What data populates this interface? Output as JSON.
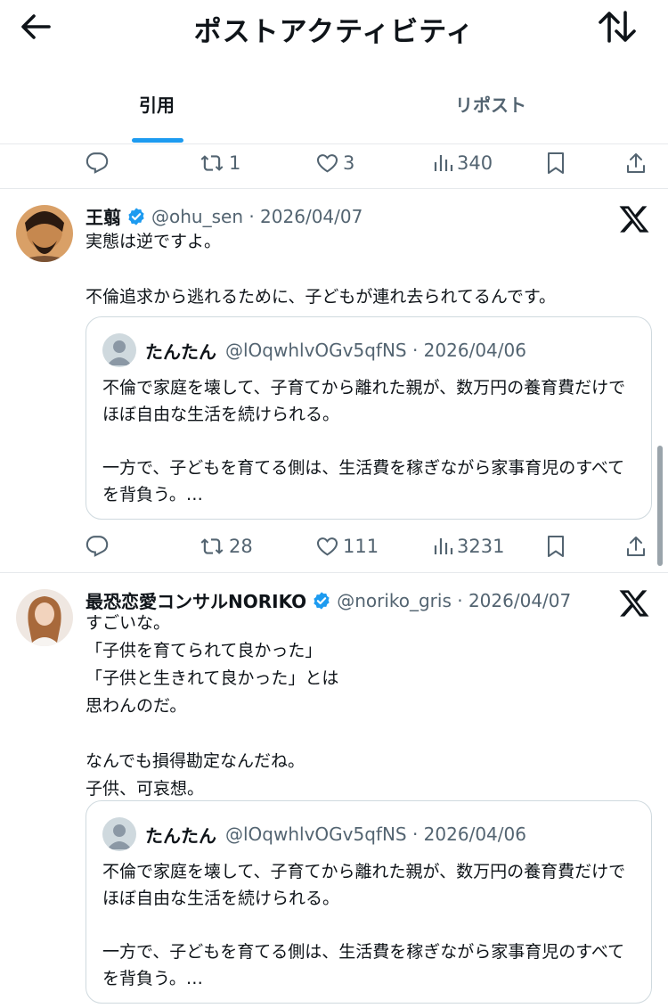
{
  "header": {
    "title": "ポストアクティビティ",
    "back_icon": "arrow-left-icon",
    "sort_icon": "sort-arrows-icon"
  },
  "tabs": [
    {
      "label": "引用",
      "active": true
    },
    {
      "label": "リポスト",
      "active": false
    }
  ],
  "top_actions": {
    "replies": "",
    "reposts": "1",
    "likes": "3",
    "views": "340"
  },
  "posts": [
    {
      "author": "王翦",
      "verified": true,
      "handle_date": "@ohu_sen · 2026/04/07",
      "body": "実態は逆ですよ。\n\n不倫追求から逃れるために、子どもが連れ去られてるんです。",
      "quote": {
        "author": "たんたん",
        "handle_date": "@lOqwhlvOGv5qfNS · 2026/04/06",
        "body": "不倫で家庭を壊して、子育てから離れた親が、数万円の養育費だけでほぼ自由な生活を続けられる。\n\n一方で、子どもを育てる側は、生活費を稼ぎながら家事育児のすべてを背負う。…"
      },
      "actions": {
        "replies": "",
        "reposts": "28",
        "likes": "111",
        "views": "3231"
      }
    },
    {
      "author": "最恐恋愛コンサルNORIKO",
      "verified": true,
      "handle_date": "@noriko_gris · 2026/04/07",
      "body": "すごいな。\n「子供を育てられて良かった」\n「子供と生きれて良かった」とは\n思わんのだ。\n\nなんでも損得勘定なんだね。\n子供、可哀想。",
      "quote": {
        "author": "たんたん",
        "handle_date": "@lOqwhlvOGv5qfNS · 2026/04/06",
        "body": "不倫で家庭を壊して、子育てから離れた親が、数万円の養育費だけでほぼ自由な生活を続けられる。\n\n一方で、子どもを育てる側は、生活費を稼ぎながら家事育児のすべてを背負う。…"
      }
    }
  ],
  "colors": {
    "accent": "#1d9bf0",
    "muted": "#536471",
    "text": "#0f1419",
    "border": "#cfd9de"
  }
}
